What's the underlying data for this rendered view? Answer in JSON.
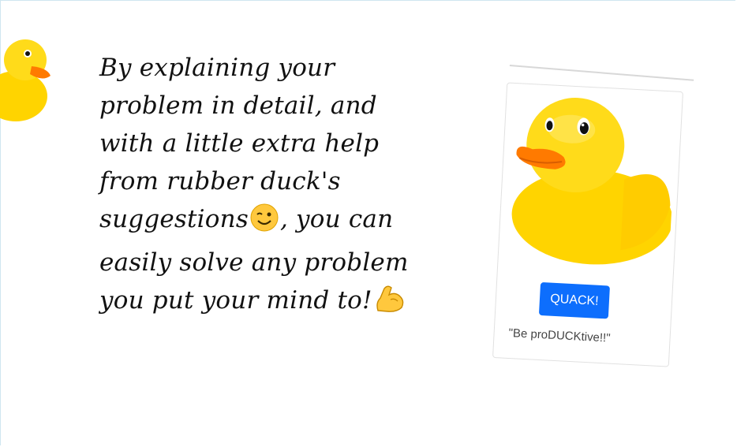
{
  "intro_text": {
    "part1": "By explaining your problem in detail, and with a little extra help from rubber duck's suggestions",
    "part2": ", you can easily solve any problem you put your mind to!"
  },
  "icons": {
    "corner": "rubber-duck-icon",
    "wink": "winking-face-emoji",
    "muscle": "flexed-biceps-emoji",
    "card_image": "rubber-duck-image"
  },
  "card": {
    "button_label": "QUACK!",
    "quote": "\"Be proDUCKtive!!\""
  },
  "colors": {
    "duck_yellow": "#FFD400",
    "beak_orange": "#FF7A00",
    "button_blue": "#0D6EFD",
    "frame_border": "#CFE6F0"
  }
}
